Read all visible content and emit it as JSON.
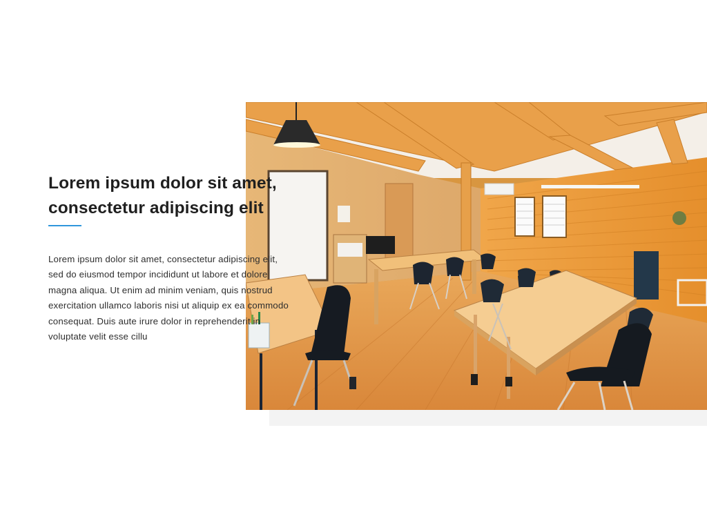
{
  "section": {
    "heading_lines": [
      "Lorem ipsum dolor sit amet,",
      "consectetur adipiscing elit"
    ],
    "body_lines": [
      "Lorem ipsum dolor sit amet, consectetur adipiscing elit,",
      "sed do eiusmod tempor incididunt ut labore et dolore",
      "magna aliqua. Ut enim ad minim veniam, quis nostrud",
      "exercitation ullamco laboris nisi ut aliquip ex ea commodo",
      "consequat. Duis aute irure dolor in reprehenderit in",
      "voluptate velit esse cillu"
    ],
    "accent_color": "#2f96dc"
  },
  "image": {
    "subject": "wooden-coworking-room-photo"
  }
}
